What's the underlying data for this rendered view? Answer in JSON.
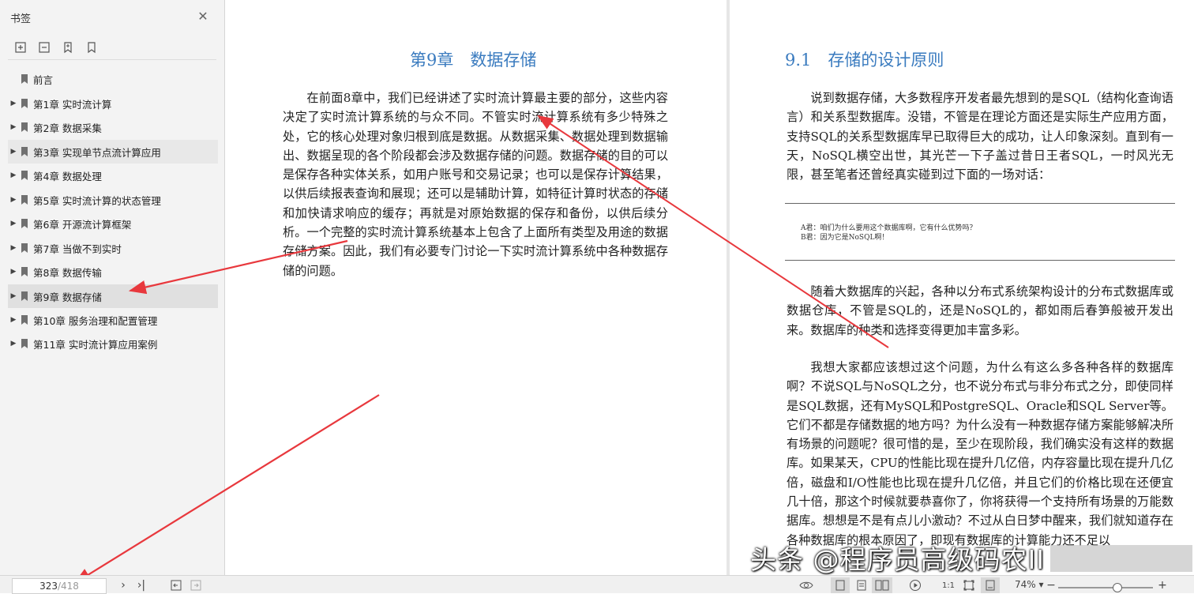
{
  "sidebar": {
    "title": "书签",
    "items": [
      {
        "label": "前言",
        "expandable": false
      },
      {
        "label": "第1章 实时流计算",
        "expandable": true
      },
      {
        "label": "第2章 数据采集",
        "expandable": true
      },
      {
        "label": "第3章 实现单节点流计算应用",
        "expandable": true
      },
      {
        "label": "第4章 数据处理",
        "expandable": true
      },
      {
        "label": "第5章 实时流计算的状态管理",
        "expandable": true
      },
      {
        "label": "第6章 开源流计算框架",
        "expandable": true
      },
      {
        "label": "第7章 当做不到实时",
        "expandable": true
      },
      {
        "label": "第8章 数据传输",
        "expandable": true
      },
      {
        "label": "第9章 数据存储",
        "expandable": true
      },
      {
        "label": "第10章 服务治理和配置管理",
        "expandable": true
      },
      {
        "label": "第11章 实时流计算应用案例",
        "expandable": true
      }
    ]
  },
  "left_page": {
    "chapter_title": "第9章　数据存储",
    "paragraph": "在前面8章中，我们已经讲述了实时流计算最主要的部分，这些内容决定了实时流计算系统的与众不同。不管实时流计算系统有多少特殊之处，它的核心处理对象归根到底是数据。从数据采集、数据处理到数据输出、数据呈现的各个阶段都会涉及数据存储的问题。数据存储的目的可以是保存各种实体关系，如用户账号和交易记录；也可以是保存计算结果，以供后续报表查询和展现；还可以是辅助计算，如特征计算时状态的存储和加快请求响应的缓存；再就是对原始数据的保存和备份，以供后续分析。一个完整的实时流计算系统基本上包含了上面所有类型及用途的数据存储方案。因此，我们有必要专门讨论一下实时流计算系统中各种数据存储的问题。"
  },
  "right_page": {
    "section_title": "9.1　存储的设计原则",
    "para1": "说到数据存储，大多数程序开发者最先想到的是SQL（结构化查询语言）和关系型数据库。没错，不管是在理论方面还是实际生产应用方面，支持SQL的关系型数据库早已取得巨大的成功，让人印象深刻。直到有一天，NoSQL横空出世，其光芒一下子盖过昔日王者SQL，一时风光无限，甚至笔者还曾经真实碰到过下面的一场对话：",
    "dialog_a": "A君：咱们为什么要用这个数据库啊，它有什么优势吗？",
    "dialog_b": "B君：因为它是NoSQL啊！",
    "para2": "随着大数据库的兴起，各种以分布式系统架构设计的分布式数据库或数据仓库，不管是SQL的，还是NoSQL的，都如雨后春笋般被开发出来。数据库的种类和选择变得更加丰富多彩。",
    "para3": "我想大家都应该想过这个问题，为什么有这么多各种各样的数据库啊？不说SQL与NoSQL之分，也不说分布式与非分布式之分，即使同样是SQL数据，还有MySQL和PostgreSQL、Oracle和SQL Server等。它们不都是存储数据的地方吗？为什么没有一种数据存储方案能够解决所有场景的问题呢？很可惜的是，至少在现阶段，我们确实没有这样的数据库。如果某天，CPU的性能比现在提升几亿倍，内存容量比现在提升几亿倍，磁盘和I/O性能也比现在提升几亿倍，并且它们的价格比现在还便宜几十倍，那这个时候就要恭喜你了，你将获得一个支持所有场景的万能数据库。想想是不是有点儿小激动？不过从白日梦中醒来，我们就知道存在各种数据库的根本原因了，即现有数据库的计算能力还不足以"
  },
  "watermark": "头条 @程序员高级码农II",
  "statusbar": {
    "page_current": "323",
    "page_total": "/418",
    "zoom": "74%",
    "zoom_level": 0.62
  },
  "colors": {
    "accent": "#3a7bbf",
    "annotation": "#e8383d"
  }
}
